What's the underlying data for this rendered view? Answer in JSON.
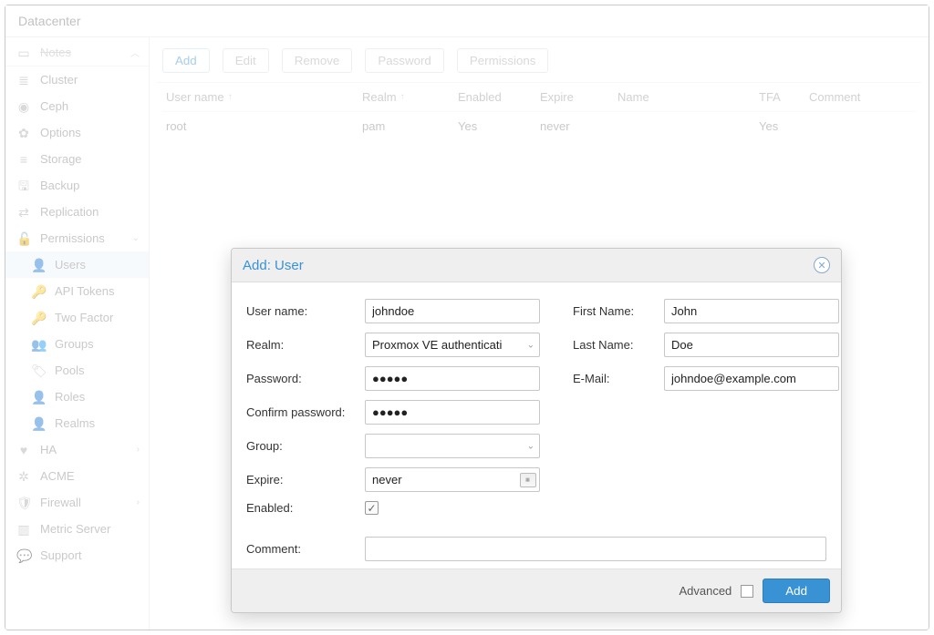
{
  "header": {
    "title": "Datacenter"
  },
  "sidebar": {
    "notes": "Notes",
    "items": [
      {
        "icon": "≣",
        "label": "Cluster"
      },
      {
        "icon": "◉",
        "label": "Ceph"
      },
      {
        "icon": "✿",
        "label": "Options"
      },
      {
        "icon": "≡",
        "label": "Storage"
      },
      {
        "icon": "🖫",
        "label": "Backup"
      },
      {
        "icon": "⇄",
        "label": "Replication"
      },
      {
        "icon": "🔓",
        "label": "Permissions",
        "expand": true
      }
    ],
    "perm_children": [
      {
        "icon": "👤",
        "label": "Users",
        "selected": true
      },
      {
        "icon": "🔑",
        "label": "API Tokens"
      },
      {
        "icon": "🔑",
        "label": "Two Factor"
      },
      {
        "icon": "👥",
        "label": "Groups"
      },
      {
        "icon": "🏷",
        "label": "Pools"
      },
      {
        "icon": "👤",
        "label": "Roles"
      },
      {
        "icon": "👤",
        "label": "Realms"
      }
    ],
    "tail": [
      {
        "icon": "♥",
        "label": "HA",
        "expand": true
      },
      {
        "icon": "✲",
        "label": "ACME"
      },
      {
        "icon": "🛡",
        "label": "Firewall",
        "expand": true
      },
      {
        "icon": "▥",
        "label": "Metric Server"
      },
      {
        "icon": "💬",
        "label": "Support"
      }
    ]
  },
  "toolbar": {
    "add": "Add",
    "edit": "Edit",
    "remove": "Remove",
    "password": "Password",
    "permissions": "Permissions"
  },
  "table": {
    "headers": {
      "username": "User name",
      "realm": "Realm",
      "enabled": "Enabled",
      "expire": "Expire",
      "name": "Name",
      "tfa": "TFA",
      "comment": "Comment"
    },
    "row": {
      "username": "root",
      "realm": "pam",
      "enabled": "Yes",
      "expire": "never",
      "name": "",
      "tfa": "Yes",
      "comment": ""
    }
  },
  "dialog": {
    "title": "Add: User",
    "labels": {
      "username": "User name:",
      "realm": "Realm:",
      "password": "Password:",
      "confirm": "Confirm password:",
      "group": "Group:",
      "expire": "Expire:",
      "enabled": "Enabled:",
      "firstname": "First Name:",
      "lastname": "Last Name:",
      "email": "E-Mail:",
      "comment": "Comment:",
      "advanced": "Advanced"
    },
    "values": {
      "username": "johndoe",
      "realm": "Proxmox VE authenticati",
      "password": "●●●●●",
      "confirm": "●●●●●",
      "group": "",
      "expire": "never",
      "enabled_checked": "✓",
      "firstname": "John",
      "lastname": "Doe",
      "email": "johndoe@example.com",
      "comment": ""
    },
    "add_button": "Add"
  }
}
